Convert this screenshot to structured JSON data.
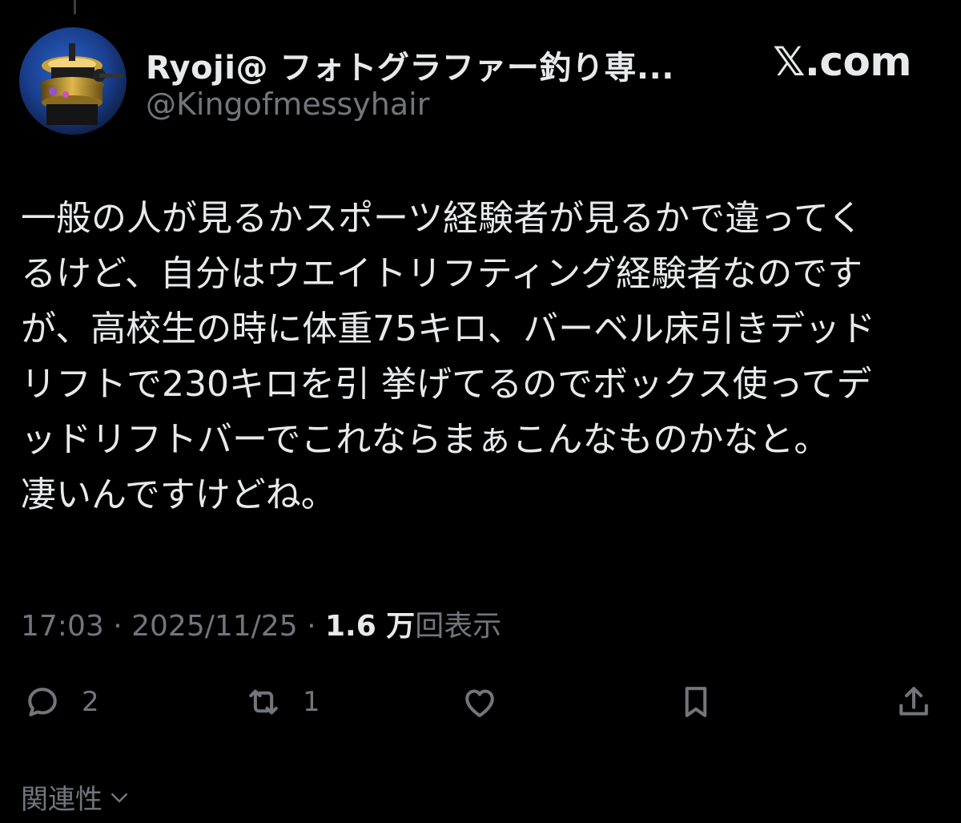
{
  "author": {
    "display_name": "Ryoji@ フォトグラファー釣り専...",
    "handle": "@Kingofmessyhair",
    "avatar_icon": "fishing-reel-avatar"
  },
  "brand": {
    "label": "𝕏.com"
  },
  "tweet": {
    "lines": [
      "一般の人が見るかスポーツ経験者が見るかで違ってく",
      "るけど、自分はウエイトリフティング経験者なのです",
      "が、高校生の時に体重75キロ、バーベル床引きデッド",
      "リフトで230キロを引 挙げてるのでボックス使ってデ",
      "ッドリフトバーでこれならまぁこんなものかなと。",
      "凄いんですけどね。"
    ]
  },
  "meta": {
    "time": "17:03",
    "separator": "·",
    "date": "2025/11/25",
    "views_count": "1.6 万",
    "views_label": "回表示"
  },
  "actions": {
    "reply": {
      "icon": "reply-icon",
      "count": "2"
    },
    "repost": {
      "icon": "repost-icon",
      "count": "1"
    },
    "like": {
      "icon": "heart-icon"
    },
    "bookmark": {
      "icon": "bookmark-icon"
    },
    "share": {
      "icon": "share-icon"
    }
  },
  "relevance": {
    "label": "関連性",
    "icon": "chevron-down-icon"
  },
  "colors": {
    "background": "#000000",
    "primary_text": "#e7e9ea",
    "secondary_text": "#71767b"
  }
}
